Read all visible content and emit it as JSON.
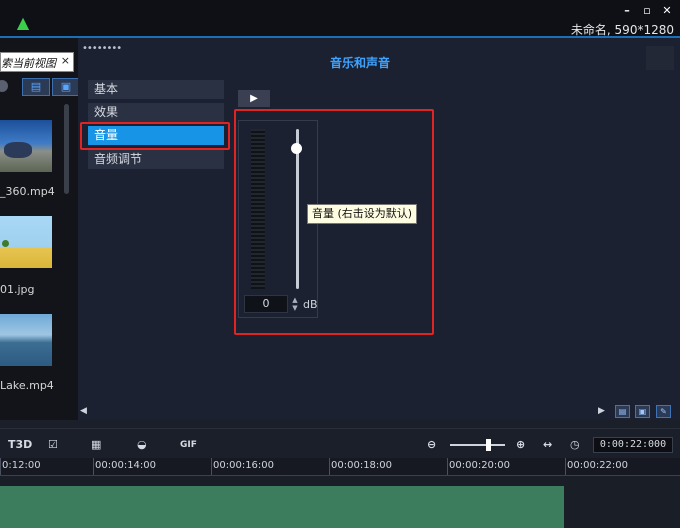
{
  "window": {
    "title": "未命名, 590*1280",
    "up_icon": "up-arrow-icon",
    "controls": [
      "–",
      "▫",
      "✕"
    ]
  },
  "library": {
    "tab_label": "索当前视图",
    "tab_close": "×",
    "items": [
      {
        "label": "_360.mp4"
      },
      {
        "label": "01.jpg"
      },
      {
        "label": "Lake.mp4"
      }
    ]
  },
  "options_panel": {
    "title": "音乐和声音",
    "menu": [
      {
        "label": "基本",
        "active": false
      },
      {
        "label": "效果",
        "active": false
      },
      {
        "label": "音量",
        "active": true
      },
      {
        "label": "音频调节",
        "active": false
      }
    ],
    "play_symbol": "▶",
    "volume": {
      "value": "0",
      "unit": "dB",
      "level": 0.88
    },
    "tooltip": "音量 (右击设为默认)"
  },
  "timeline": {
    "timecode": "0:00:22:000",
    "tools": [
      "T3D",
      "GIF"
    ],
    "ruler": [
      "0:12:00",
      "00:00:14:00",
      "00:00:16:00",
      "00:00:18:00",
      "00:00:20:00",
      "00:00:22:00"
    ]
  },
  "colors": {
    "accent": "#1794e6",
    "highlight": "#e02424",
    "clip": "#3b7d5c"
  }
}
